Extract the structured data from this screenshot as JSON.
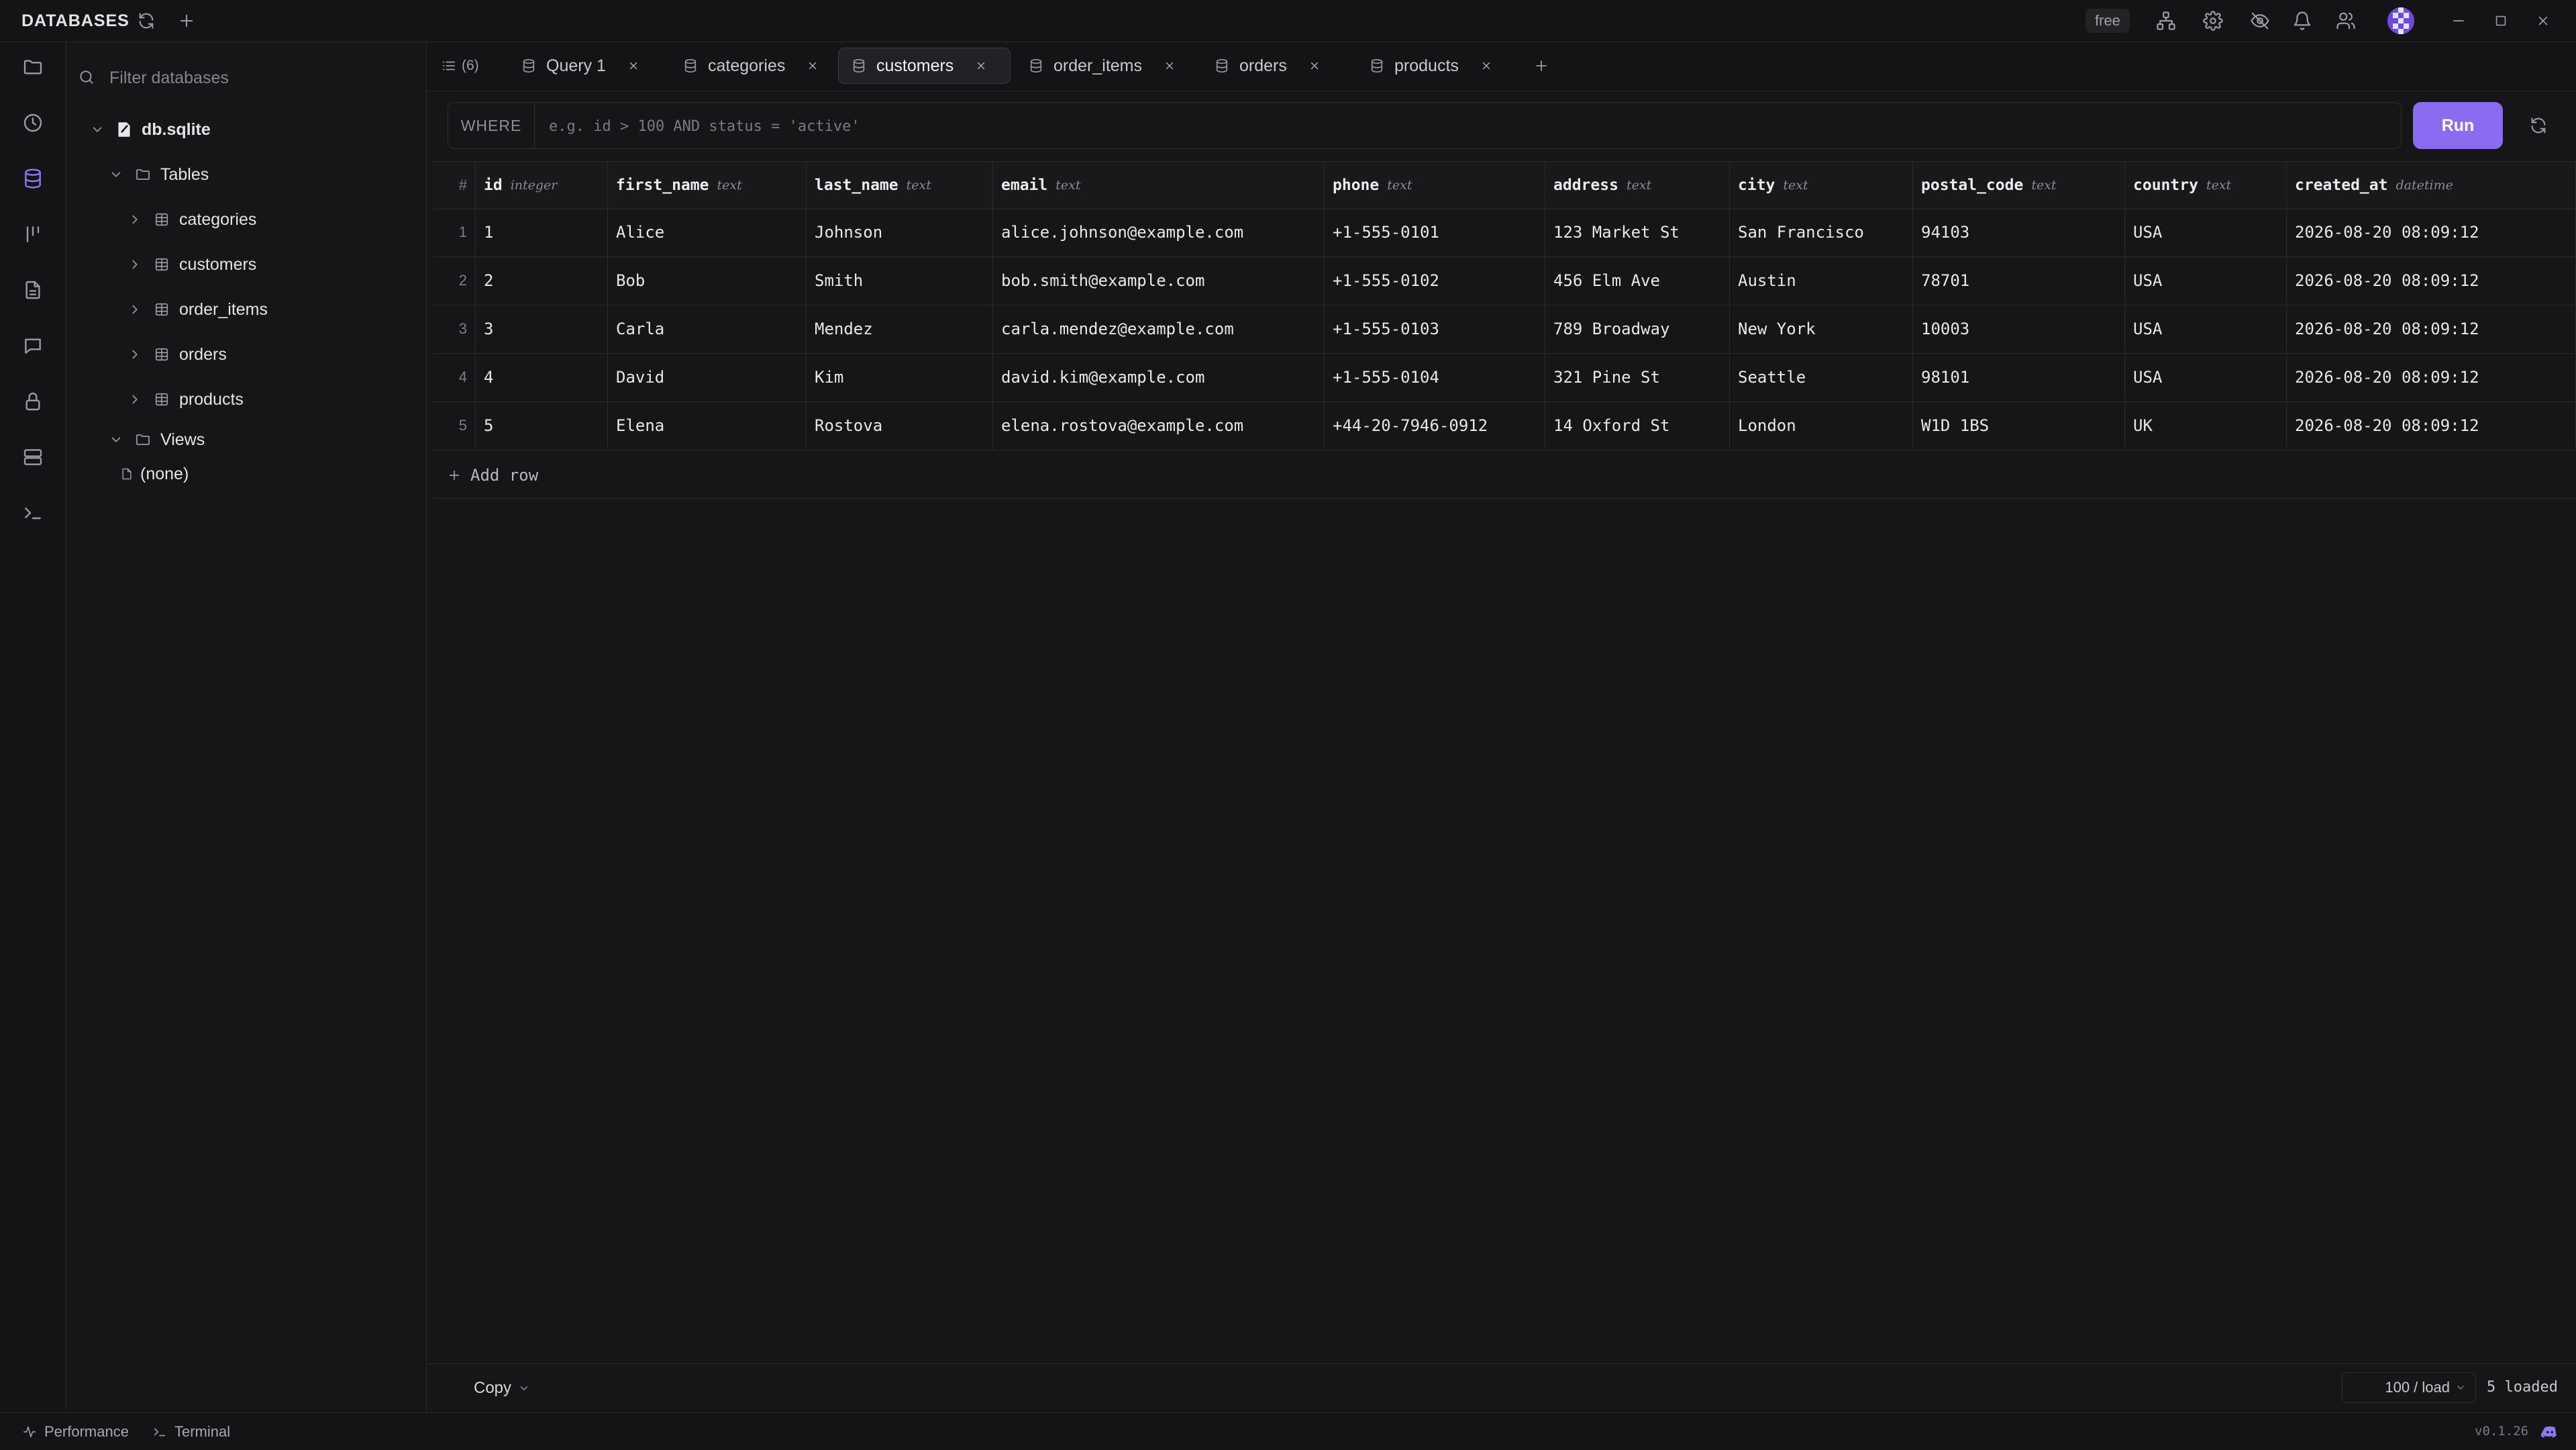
{
  "titlebar": {
    "title": "DATABASES",
    "plan_badge": "free",
    "icons": [
      "refresh-icon",
      "plus-icon",
      "diagram-icon",
      "gear-icon",
      "eye-off-icon",
      "bell-icon",
      "users-icon",
      "avatar",
      "minimize-icon",
      "maximize-icon",
      "close-icon"
    ]
  },
  "rail": {
    "items": [
      "folder-icon",
      "history-icon",
      "database-icon",
      "chart-icon",
      "file-icon",
      "chat-icon",
      "lock-icon",
      "server-icon",
      "terminal-icon"
    ],
    "active": "database-icon"
  },
  "explorer": {
    "filter_placeholder": "Filter databases",
    "database": "db.sqlite",
    "tables_label": "Tables",
    "tables": [
      "categories",
      "customers",
      "order_items",
      "orders",
      "products"
    ],
    "views_label": "Views",
    "views": [
      "(none)"
    ]
  },
  "tabs": {
    "count_label": "(6)",
    "items": [
      {
        "label": "Query 1",
        "active": false
      },
      {
        "label": "categories",
        "active": false
      },
      {
        "label": "customers",
        "active": true
      },
      {
        "label": "order_items",
        "active": false
      },
      {
        "label": "orders",
        "active": false
      },
      {
        "label": "products",
        "active": false
      }
    ]
  },
  "filter": {
    "where_label": "WHERE",
    "placeholder": "e.g. id > 100 AND status = 'active'",
    "value": "",
    "run_label": "Run"
  },
  "grid": {
    "rownum_header": "#",
    "columns": [
      {
        "name": "id",
        "type": "integer"
      },
      {
        "name": "first_name",
        "type": "text"
      },
      {
        "name": "last_name",
        "type": "text"
      },
      {
        "name": "email",
        "type": "text"
      },
      {
        "name": "phone",
        "type": "text"
      },
      {
        "name": "address",
        "type": "text"
      },
      {
        "name": "city",
        "type": "text"
      },
      {
        "name": "postal_code",
        "type": "text"
      },
      {
        "name": "country",
        "type": "text"
      },
      {
        "name": "created_at",
        "type": "datetime"
      }
    ],
    "rows": [
      {
        "num": "1",
        "cells": [
          "1",
          "Alice",
          "Johnson",
          "alice.johnson@example.com",
          "+1-555-0101",
          "123 Market St",
          "San Francisco",
          "94103",
          "USA",
          "2026-08-20 08:09:12"
        ]
      },
      {
        "num": "2",
        "cells": [
          "2",
          "Bob",
          "Smith",
          "bob.smith@example.com",
          "+1-555-0102",
          "456 Elm Ave",
          "Austin",
          "78701",
          "USA",
          "2026-08-20 08:09:12"
        ]
      },
      {
        "num": "3",
        "cells": [
          "3",
          "Carla",
          "Mendez",
          "carla.mendez@example.com",
          "+1-555-0103",
          "789 Broadway",
          "New York",
          "10003",
          "USA",
          "2026-08-20 08:09:12"
        ]
      },
      {
        "num": "4",
        "cells": [
          "4",
          "David",
          "Kim",
          "david.kim@example.com",
          "+1-555-0104",
          "321 Pine St",
          "Seattle",
          "98101",
          "USA",
          "2026-08-20 08:09:12"
        ]
      },
      {
        "num": "5",
        "cells": [
          "5",
          "Elena",
          "Rostova",
          "elena.rostova@example.com",
          "+44-20-7946-0912",
          "14 Oxford St",
          "London",
          "W1D 1BS",
          "UK",
          "2026-08-20 08:09:12"
        ]
      }
    ],
    "add_row_label": "Add row"
  },
  "footer": {
    "copy_label": "Copy",
    "page_size": "100 / load",
    "loaded": "5 loaded"
  },
  "statusbar": {
    "performance": "Performance",
    "terminal": "Terminal",
    "version": "v0.1.26"
  },
  "colors": {
    "accent": "#8b6cf0",
    "background": "#161618",
    "border": "#2a2a2e"
  }
}
